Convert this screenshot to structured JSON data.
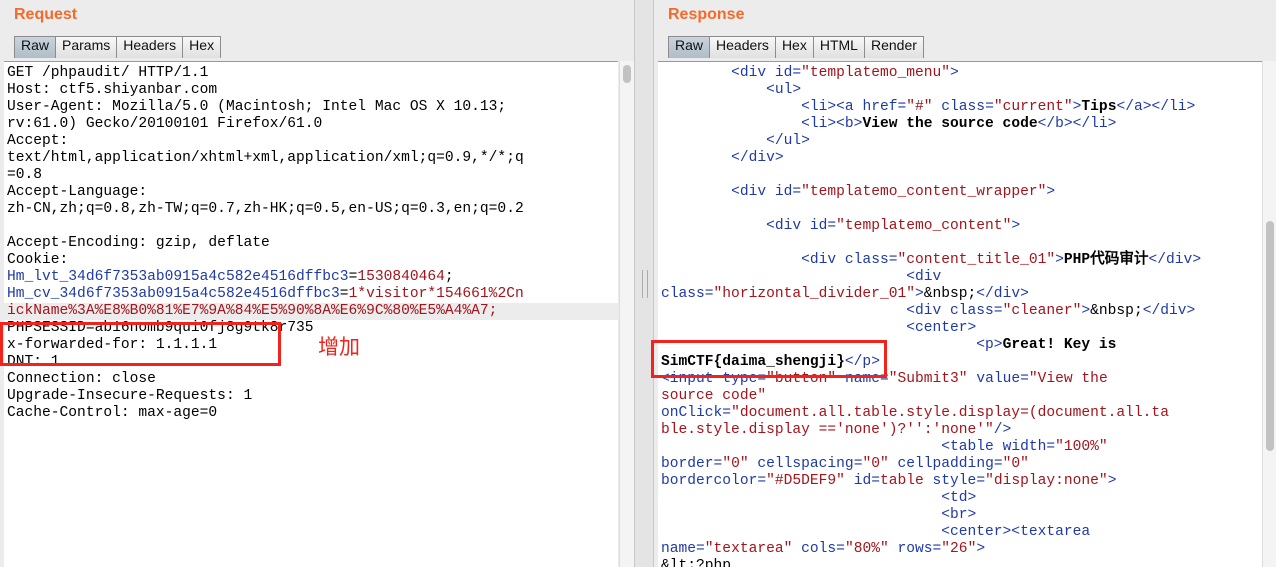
{
  "request": {
    "title": "Request",
    "tabs": [
      "Raw",
      "Params",
      "Headers",
      "Hex"
    ],
    "lines": [
      "GET /phpaudit/ HTTP/1.1",
      "Host: ctf5.shiyanbar.com",
      "User-Agent: Mozilla/5.0 (Macintosh; Intel Mac OS X 10.13;",
      "rv:61.0) Gecko/20100101 Firefox/61.0",
      "Accept:",
      "text/html,application/xhtml+xml,application/xml;q=0.9,*/*;q",
      "=0.8",
      "Accept-Language:",
      "zh-CN,zh;q=0.8,zh-TW;q=0.7,zh-HK;q=0.5,en-US;q=0.3,en;q=0.2",
      "",
      "Accept-Encoding: gzip, deflate",
      "Cookie:"
    ],
    "cookie_1_key": "Hm_lvt_34d6f7353ab0915a4c582e4516dffbc3",
    "cookie_1_value": "1530840464",
    "cookie_2_key": "Hm_cv_34d6f7353ab0915a4c582e4516dffbc3",
    "cookie_2_value_a": "1*visitor*154661%2Cn",
    "cookie_2_value_b": "ickName%3A%E8%B0%81%E7%9A%84%E5%90%8A%E6%9C%80%E5%A4%A7;",
    "cookie_3": "PHPSESSID=ab16nomb9qui0fj8g9tk8r735",
    "added_header": "x-forwarded-for: 1.1.1.1",
    "dnt": "DNT: 1",
    "tail_lines": [
      "Connection: close",
      "Upgrade-Insecure-Requests: 1",
      "Cache-Control: max-age=0"
    ],
    "annotation": "增加"
  },
  "response": {
    "title": "Response",
    "tabs": [
      "Raw",
      "Headers",
      "Hex",
      "HTML",
      "Render"
    ],
    "menu_link_text": "Tips",
    "menu_item_2": "View the source code",
    "content_title": "PHP代码审计",
    "nbsp": "&nbsp;",
    "key_prefix": "Great! Key is",
    "key": "SimCTF{daima_shengji}",
    "input_value": "View the",
    "input_value_2": "source code",
    "textarea_tail": "&lt;?php"
  },
  "colors": {
    "accent_title": "#f36a2a",
    "highlight_box": "#f2231c",
    "tag": "#1f3aa8",
    "attr_value": "#a3141c"
  }
}
